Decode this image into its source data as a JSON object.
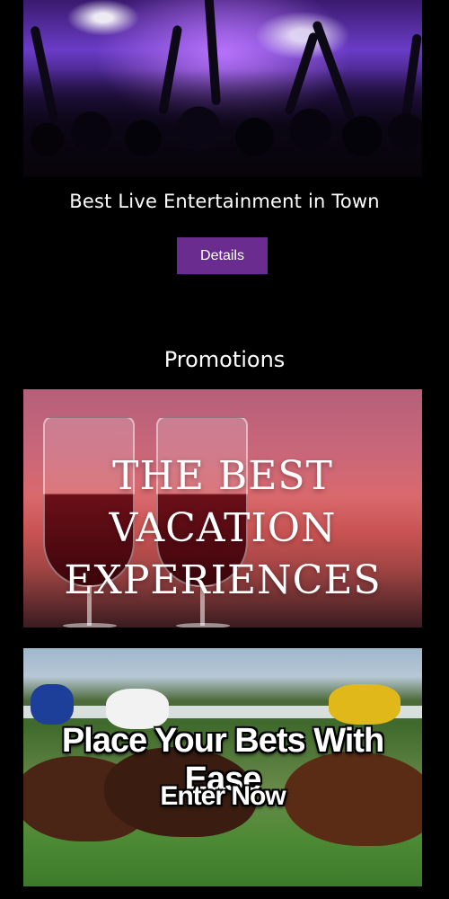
{
  "hero": {
    "title": "Best Live Entertainment in Town",
    "details_label": "Details"
  },
  "promotions": {
    "heading": "Promotions",
    "items": [
      {
        "line1": "THE BEST VACATION",
        "line2": "EXPERIENCES"
      },
      {
        "title": "Place Your Bets With Ease",
        "cta": "Enter Now"
      }
    ]
  },
  "colors": {
    "background": "#000000",
    "button": "#6a2d8f",
    "text": "#ffffff"
  }
}
